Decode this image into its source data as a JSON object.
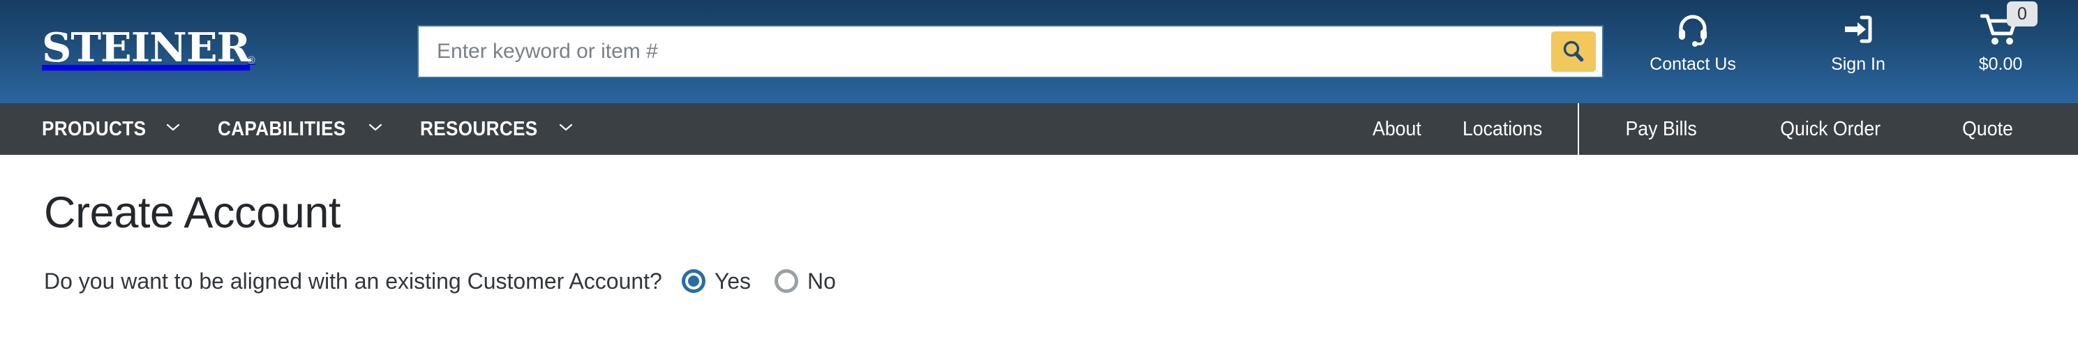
{
  "header": {
    "logo": {
      "text": "Steiner",
      "trademark": "®",
      "icon": "steiner-logo"
    },
    "search": {
      "placeholder": "Enter keyword or item #",
      "value": "",
      "button_icon": "search-icon",
      "button_color": "#f2c75c"
    },
    "utilities": [
      {
        "id": "contact",
        "label": "Contact Us",
        "icon": "headset-icon"
      },
      {
        "id": "signin",
        "label": "Sign In",
        "icon": "sign-in-arrow-icon"
      },
      {
        "id": "cart",
        "label": "$0.00",
        "icon": "shopping-cart-icon",
        "badge": "0"
      }
    ]
  },
  "nav": {
    "primary": [
      {
        "label": "PRODUCTS",
        "icon": "chevron-down-icon"
      },
      {
        "label": "CAPABILITIES",
        "icon": "chevron-down-icon"
      },
      {
        "label": "RESOURCES",
        "icon": "chevron-down-icon"
      }
    ],
    "secondary": [
      {
        "label": "About"
      },
      {
        "label": "Locations"
      }
    ],
    "actions": [
      {
        "label": "Pay Bills"
      },
      {
        "label": "Quick Order"
      },
      {
        "label": "Quote"
      }
    ]
  },
  "main": {
    "title": "Create Account",
    "question": "Do you want to be aligned with an existing Customer Account?",
    "radio_options": [
      {
        "label": "Yes",
        "selected": true
      },
      {
        "label": "No",
        "selected": false
      }
    ]
  },
  "colors": {
    "header_top": "#173d63",
    "header_bottom": "#2b659e",
    "nav_bg": "#3b4044",
    "accent_gold": "#f2c75c",
    "radio_selected": "#2b6ca3",
    "radio_unselected": "#9aa0a6",
    "text_dark": "#24272b"
  }
}
